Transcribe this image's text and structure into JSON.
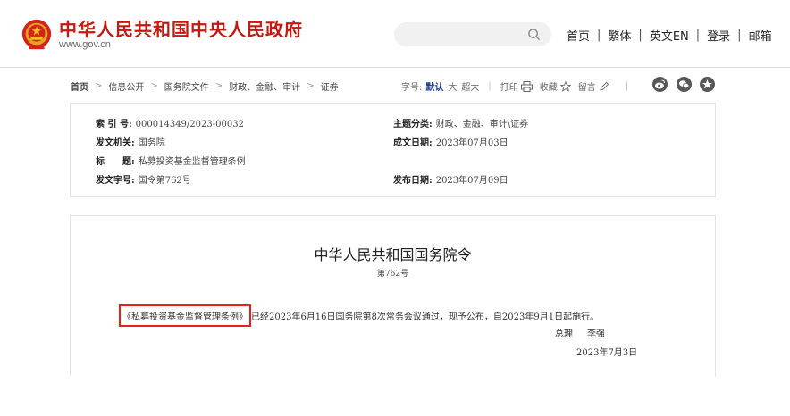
{
  "header": {
    "site_title": "中华人民共和国中央人民政府",
    "site_domain": "www.gov.cn",
    "search_placeholder": "",
    "nav": [
      "首页",
      "繁体",
      "英文EN",
      "登录",
      "邮箱"
    ],
    "brand_color": "#c51a12"
  },
  "breadcrumb": {
    "home": "首页",
    "items": [
      "信息公开",
      "国务院文件",
      "财政、金融、审计",
      "证券"
    ]
  },
  "tools": {
    "font_size_label": "字号:",
    "font_default": "默认",
    "font_large": "大",
    "font_xlarge": "超大",
    "print": "打印",
    "favorite": "收藏",
    "comment": "留言",
    "share_icons": [
      "weibo-icon",
      "wechat-icon",
      "qzone-icon"
    ]
  },
  "info": {
    "index_label": "索 引 号:",
    "index_value": "000014349/2023-00032",
    "category_label": "主题分类:",
    "category_value": "财政、金融、审计\\证券",
    "issuer_label": "发文机关:",
    "issuer_value": "国务院",
    "written_date_label": "成文日期:",
    "written_date_value": "2023年07月03日",
    "title_label": "标　　题:",
    "title_value": "私募投资基金监督管理条例",
    "doc_no_label": "发文字号:",
    "doc_no_value": "国令第762号",
    "publish_date_label": "发布日期:",
    "publish_date_value": "2023年07月09日"
  },
  "document": {
    "title": "中华人民共和国国务院令",
    "number": "第762号",
    "highlighted": "《私募投资基金监督管理条例》",
    "body_rest": "已经2023年6月16日国务院第8次常务会议通过，现予公布，自2023年9月1日起施行。",
    "signer_title": "总理",
    "signer_name": "李强",
    "date": "2023年7月3日",
    "highlight_color": "#e2231a"
  }
}
